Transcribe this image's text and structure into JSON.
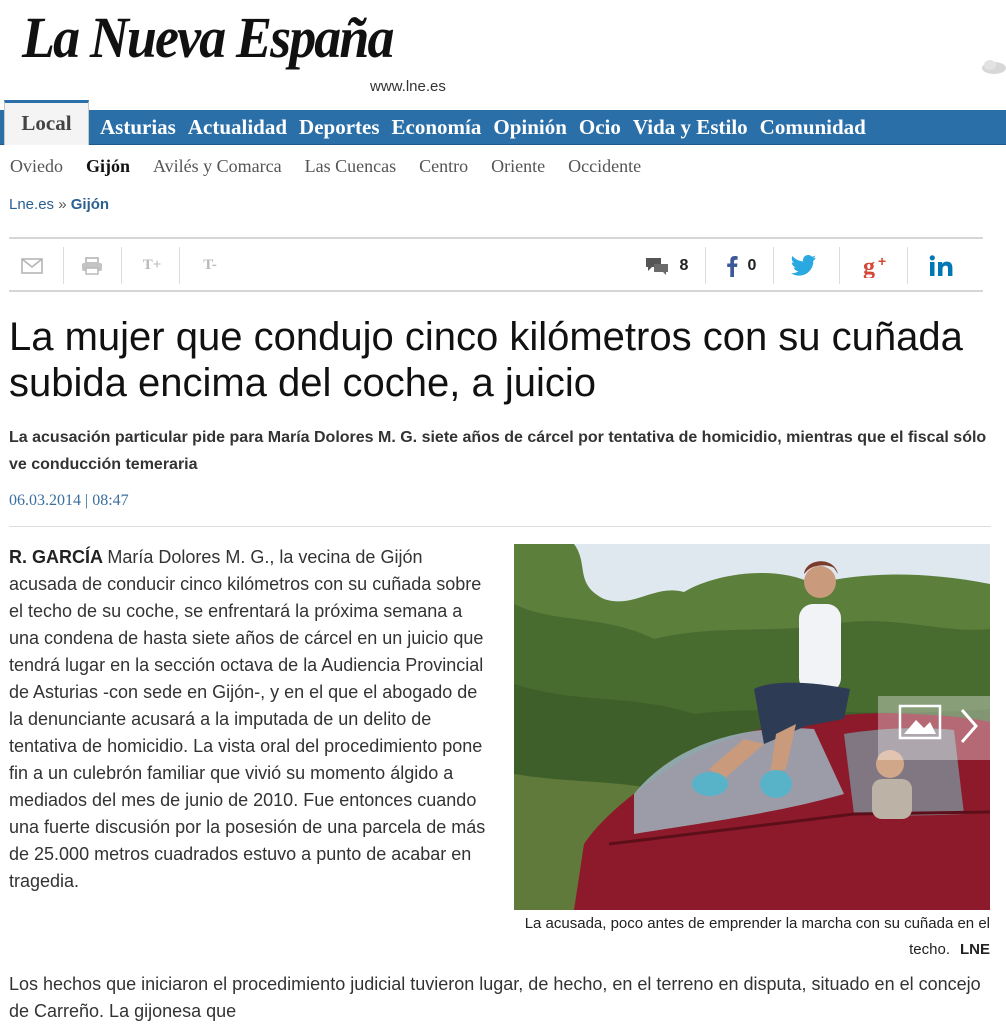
{
  "masthead": {
    "logo_text": "La Nueva España",
    "url_text": "www.lne.es"
  },
  "nav": {
    "active_tab": "Local",
    "items": [
      "Asturias",
      "Actualidad",
      "Deportes",
      "Economía",
      "Opinión",
      "Ocio",
      "Vida y Estilo",
      "Comunidad"
    ]
  },
  "subnav": {
    "items": [
      "Oviedo",
      "Gijón",
      "Avilés y Comarca",
      "Las Cuencas",
      "Centro",
      "Oriente",
      "Occidente"
    ],
    "active": "Gijón"
  },
  "breadcrumb": {
    "home": "Lne.es",
    "separator": "»",
    "current": "Gijón"
  },
  "toolbar": {
    "font_increase": "T+",
    "font_decrease": "T-",
    "comments_count": "8",
    "facebook_count": "0"
  },
  "article": {
    "headline": "La mujer que condujo cinco kilómetros con su cuñada subida encima del coche, a juicio",
    "subtitle": "La acusación particular pide para María Dolores M. G. siete años de cárcel por tentativa de homicidio, mientras que el fiscal sólo ve conducción temeraria",
    "date": "06.03.2014 | 08:47",
    "author": "R. GARCÍA",
    "paragraph1": "María Dolores M. G., la vecina de Gijón acusada de conducir cinco kilómetros con su cuñada sobre el techo de su coche, se enfrentará la próxima semana a una condena de hasta siete años de cárcel en un juicio que tendrá lugar en la sección octava de la Audiencia Provincial de Asturias -con sede en Gijón-, y en el que el abogado de la denunciante acusará a la imputada de un delito de tentativa de homicidio. La vista oral del procedimiento pone fin a un culebrón familiar que vivió su momento álgido a mediados del mes de junio de 2010. Fue entonces cuando una fuerte discusión por la posesión de una parcela de más de 25.000 metros cuadrados estuvo a punto de acabar en tragedia.",
    "paragraph2": "Los hechos que iniciaron el procedimiento judicial tuvieron lugar, de hecho, en el terreno en disputa, situado en el concejo de Carreño. La gijonesa que",
    "photo_caption": "La acusada, poco antes de emprender la marcha con su cuñada en el techo.",
    "photo_credit": "LNE"
  },
  "colors": {
    "nav_blue": "#2b6fa8",
    "link_blue": "#2b5f91",
    "date_blue": "#3a6f9f",
    "facebook": "#3b5998",
    "twitter": "#2aa9e0",
    "google_plus": "#d34836",
    "linkedin": "#0077b5"
  },
  "icons": [
    "email-icon",
    "print-icon",
    "comments-icon",
    "facebook-icon",
    "twitter-icon",
    "google-plus-icon",
    "linkedin-icon",
    "gallery-icon",
    "weather-icon"
  ]
}
